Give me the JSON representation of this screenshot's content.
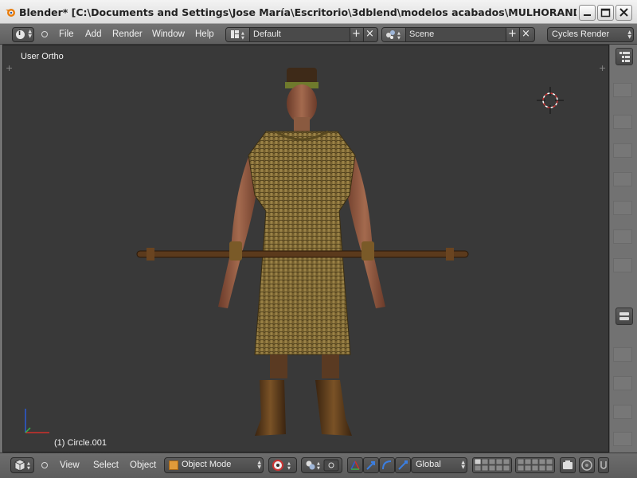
{
  "window": {
    "title": "Blender* [C:\\Documents and Settings\\Jose María\\Escritorio\\3dblend\\modelos acabados\\MULHORAND\\clerigos\\c..."
  },
  "menu": {
    "items": [
      "File",
      "Add",
      "Render",
      "Window",
      "Help"
    ]
  },
  "layout": {
    "name": "Default"
  },
  "scene": {
    "name": "Scene"
  },
  "render_engine": {
    "label": "Cycles Render"
  },
  "viewport": {
    "view_name": "User Ortho",
    "object_info": "(1) Circle.001"
  },
  "bottom": {
    "menu_items": [
      "View",
      "Select",
      "Object"
    ],
    "mode": "Object Mode",
    "orientation": "Global"
  },
  "colors": {
    "viewport_bg": "#393939",
    "header_bg": "#727272",
    "accent_object": "#e09a3a"
  }
}
